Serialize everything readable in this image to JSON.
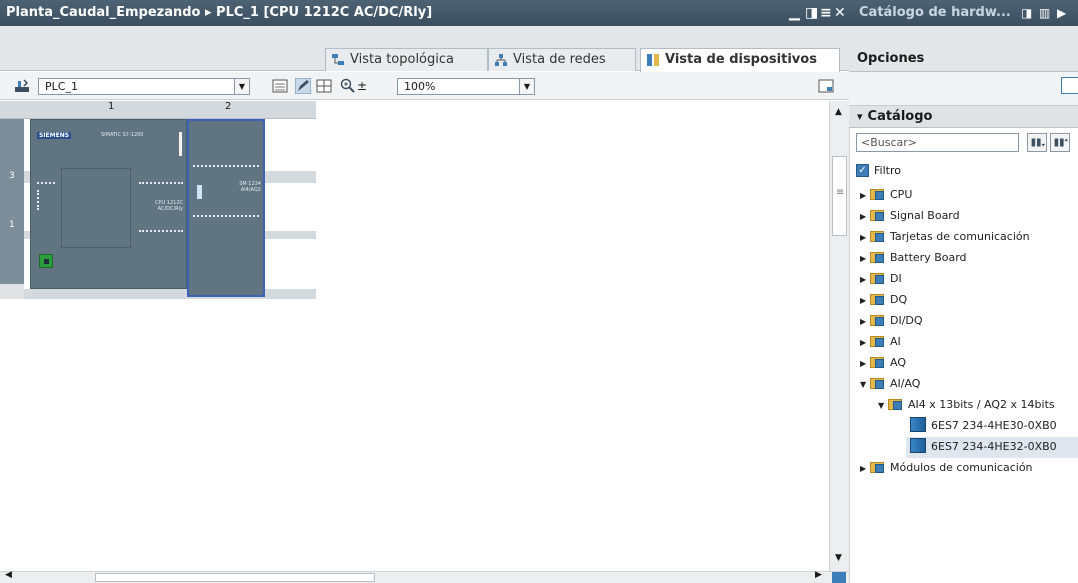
{
  "left_window": {
    "title": "Planta_Caudal_Empezando  ▸  PLC_1 [CPU 1212C AC/DC/Rly]",
    "tabs": [
      {
        "label": "Vista topológica"
      },
      {
        "label": "Vista de redes"
      },
      {
        "label": "Vista de dispositivos"
      }
    ],
    "device_select": "PLC_1",
    "zoom_value": "100%",
    "rack_cols": [
      "1",
      "2"
    ],
    "rack_rows": [
      "3",
      "1"
    ],
    "module_texts": {
      "brand": "SIEMENS",
      "cpu_model": "SIMATIC S7-1200",
      "cpu_label": "CPU 1212C AC/DC/Rly",
      "sm_label": "SM 1234 AI4/AQ2"
    }
  },
  "right_window": {
    "title": "Catálogo de hardw...",
    "options_label": "Opciones",
    "catalog_label": "Catálogo",
    "search_placeholder": "<Buscar>",
    "filter_label": "Filtro",
    "filter_checked": true,
    "tree": [
      {
        "label": "CPU",
        "expanded": false
      },
      {
        "label": "Signal Board",
        "expanded": false
      },
      {
        "label": "Tarjetas de comunicación",
        "expanded": false
      },
      {
        "label": "Battery Board",
        "expanded": false
      },
      {
        "label": "DI",
        "expanded": false
      },
      {
        "label": "DQ",
        "expanded": false
      },
      {
        "label": "DI/DQ",
        "expanded": false
      },
      {
        "label": "AI",
        "expanded": false
      },
      {
        "label": "AQ",
        "expanded": false
      },
      {
        "label": "AI/AQ",
        "expanded": true
      },
      {
        "label": "AI4 x 13bits / AQ2 x 14bits",
        "expanded": true
      },
      {
        "label": "6ES7 234-4HE30-0XB0"
      },
      {
        "label": "6ES7 234-4HE32-0XB0",
        "selected": true
      },
      {
        "label": "Módulos de comunicación",
        "expanded": false
      }
    ]
  },
  "colors": {
    "title_bar": "#425769",
    "selection": "#3c63b8",
    "catalog_selected_row": "#dfe6ee",
    "plc_body": "#5f7480"
  }
}
